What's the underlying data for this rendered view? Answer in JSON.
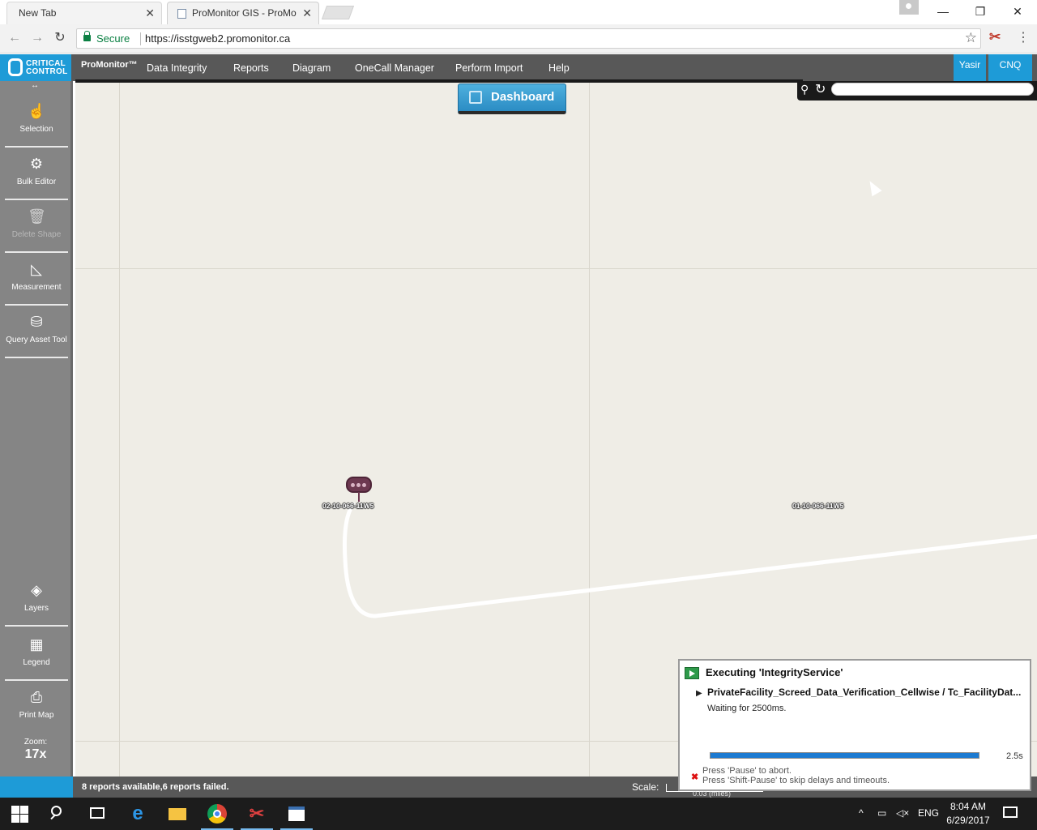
{
  "browser": {
    "tabs": [
      {
        "title": "New Tab"
      },
      {
        "title": "ProMonitor GIS - ProMo"
      }
    ],
    "secure_label": "Secure",
    "url": "https://isstgweb2.promonitor.ca"
  },
  "app": {
    "logo_line1": "CRITICAL",
    "logo_line2": "CONTROL",
    "brand": "ProMonitor™",
    "menu": [
      "Data Integrity",
      "Reports",
      "Diagram",
      "OneCall Manager",
      "Perform Import",
      "Help"
    ],
    "user": "Yasir",
    "company": "CNQ"
  },
  "sidebar": {
    "tools": [
      {
        "label": "Selection",
        "icon": "hand-pointer-icon"
      },
      {
        "label": "Bulk Editor",
        "icon": "bulk-editor-icon"
      },
      {
        "label": "Delete Shape",
        "icon": "trash-icon",
        "disabled": true
      },
      {
        "label": "Measurement",
        "icon": "ruler-icon"
      },
      {
        "label": "Query Asset Tool",
        "icon": "database-icon"
      },
      {
        "label": "Layers",
        "icon": "layers-icon"
      },
      {
        "label": "Legend",
        "icon": "legend-icon"
      },
      {
        "label": "Print Map",
        "icon": "printer-icon"
      }
    ],
    "zoom_label": "Zoom:",
    "zoom_value": "17x"
  },
  "map": {
    "dashboard_label": "Dashboard",
    "search_placeholder": "",
    "labels": [
      "02-10-066-11W5",
      "01-10-066-11W5"
    ],
    "road_color": "#ffffff",
    "background_color": "#efede6",
    "marker_color": "#6d3850"
  },
  "statusbar": {
    "message": "8 reports available,6 reports failed.",
    "scale_label": "Scale:",
    "scale_value": "0.03 (miles)"
  },
  "exec_popup": {
    "title": "Executing 'IntegrityService'",
    "task": "PrivateFacility_Screed_Data_Verification_Cellwise / Tc_FacilityDat...",
    "status": "Waiting for 2500ms.",
    "progress": 1.0,
    "time": "2.5s",
    "hint1": "Press 'Pause' to abort.",
    "hint2": "Press 'Shift-Pause' to skip delays and timeouts."
  },
  "taskbar": {
    "language": "ENG",
    "time": "8:04 AM",
    "date": "6/29/2017"
  }
}
